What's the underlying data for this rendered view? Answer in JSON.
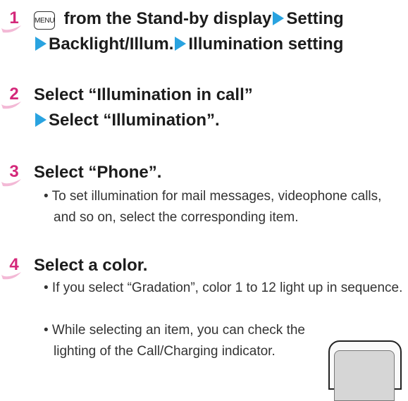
{
  "steps": [
    {
      "number": "1",
      "menu_key": "MENU",
      "line1_text": " from the Stand-by display",
      "line1_link": "Setting",
      "line2_a": "Backlight/Illum.",
      "line2_b": "Illumination setting"
    },
    {
      "number": "2",
      "line1": "Select “Illumination in call”",
      "line2": "Select “Illumination”."
    },
    {
      "number": "3",
      "line1": "Select “Phone”.",
      "bullet1": "• To set illumination for mail messages, videophone calls, and so on, select the corresponding item."
    },
    {
      "number": "4",
      "line1": "Select a color.",
      "bullet1": "• If you select “Gradation”, color 1 to 12 light up in sequence.",
      "bullet2": "• While selecting an item, you can check the lighting of the Call/Charging indicator."
    }
  ],
  "colors": {
    "step_number": "#d4287a",
    "arrow": "#29a3e0",
    "text": "#1c1c1c"
  },
  "icons": [
    "menu-key-icon",
    "triangle-arrow-icon",
    "phone-indicator-illustration"
  ]
}
